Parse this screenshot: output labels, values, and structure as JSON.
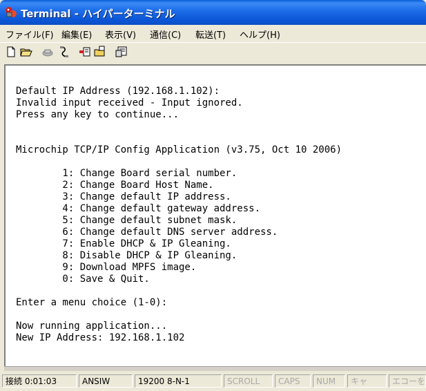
{
  "window": {
    "title": "Terminal - ハイパーターミナル"
  },
  "menu": [
    {
      "label": "ファイル(F)"
    },
    {
      "label": "編集(E)"
    },
    {
      "label": "表示(V)"
    },
    {
      "label": "通信(C)"
    },
    {
      "label": "転送(T)"
    },
    {
      "label": "ヘルプ(H)"
    }
  ],
  "toolbar": {
    "icons": [
      "new-icon",
      "open-icon",
      "connect-icon",
      "disconnect-icon",
      "send-icon",
      "receive-icon",
      "properties-icon"
    ]
  },
  "terminal": {
    "lines": [
      "Default IP Address (192.168.1.102):",
      "Invalid input received - Input ignored.",
      "Press any key to continue...",
      "",
      "",
      "Microchip TCP/IP Config Application (v3.75, Oct 10 2006)",
      "",
      "        1: Change Board serial number.",
      "        2: Change Board Host Name.",
      "        3: Change default IP address.",
      "        4: Change default gateway address.",
      "        5: Change default subnet mask.",
      "        6: Change default DNS server address.",
      "        7: Enable DHCP & IP Gleaning.",
      "        8: Disable DHCP & IP Gleaning.",
      "        9: Download MPFS image.",
      "        0: Save & Quit.",
      "",
      "Enter a menu choice (1-0):",
      "",
      "Now running application...",
      "New IP Address: 192.168.1.102"
    ]
  },
  "status": {
    "connected": "接続 0:01:03",
    "emulation": "ANSIW",
    "settings": "19200 8-N-1",
    "scroll": "SCROLL",
    "caps": "CAPS",
    "num": "NUM",
    "capture": "キャ",
    "echo": "エコーを印"
  }
}
